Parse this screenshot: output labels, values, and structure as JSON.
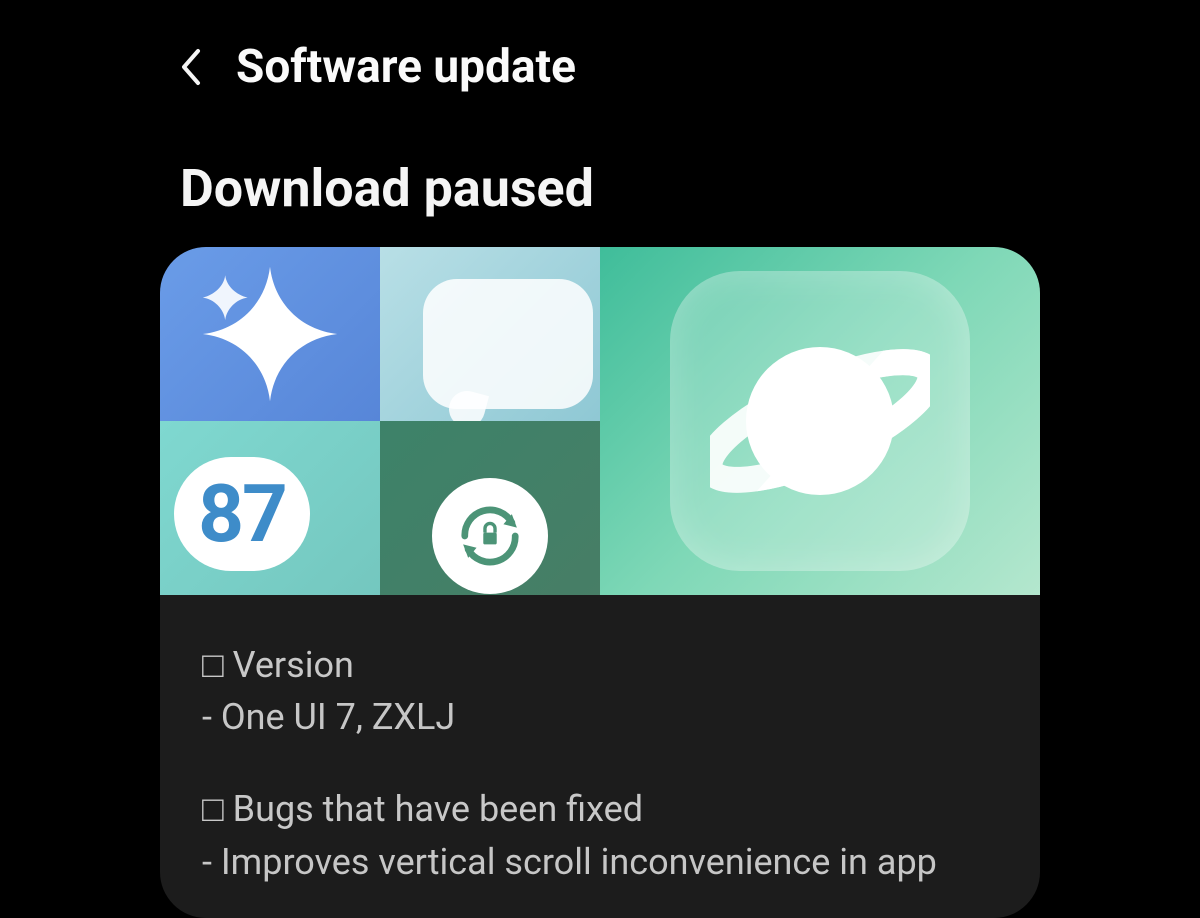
{
  "header": {
    "title": "Software update"
  },
  "status": "Download paused",
  "banner": {
    "pill_value": "87"
  },
  "release_notes": {
    "sections": [
      {
        "header": "□ Version",
        "lines": [
          "- One UI 7, ZXLJ"
        ]
      },
      {
        "header": "□ Bugs that have been fixed",
        "lines": [
          "- Improves vertical scroll inconvenience in app"
        ]
      }
    ]
  }
}
